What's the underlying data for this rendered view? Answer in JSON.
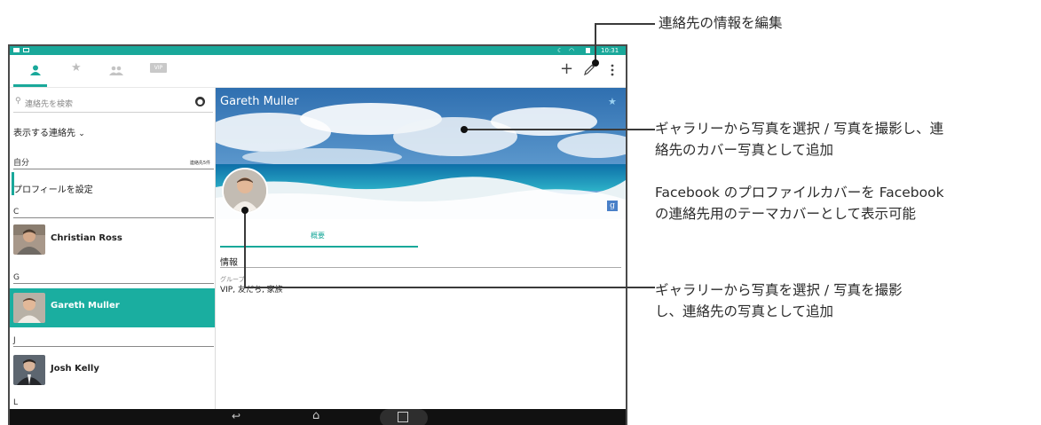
{
  "status_bar": {
    "time": "10:31"
  },
  "app_bar": {
    "tabs": [
      {
        "icon": "person-icon",
        "active": true
      },
      {
        "icon": "star-icon",
        "active": false
      },
      {
        "icon": "group-icon",
        "active": false
      },
      {
        "icon": "vip-icon",
        "label": "VIP",
        "active": false
      }
    ],
    "actions": [
      "add-icon",
      "edit-icon",
      "more-icon"
    ]
  },
  "left_panel": {
    "search_placeholder": "連絡先を検索",
    "display_contacts_label": "表示する連絡先",
    "self_section": {
      "header": "自分",
      "count": "連絡先5件",
      "setup_profile": "プロフィールを設定"
    },
    "sections": [
      {
        "letter": "C",
        "contacts": [
          "Christian Ross"
        ]
      },
      {
        "letter": "G",
        "contacts": [
          "Gareth Muller"
        ]
      },
      {
        "letter": "J",
        "contacts": [
          "Josh Kelly"
        ]
      },
      {
        "letter": "L",
        "contacts": []
      }
    ],
    "selected_contact": "Gareth Muller"
  },
  "detail": {
    "name": "Gareth Muller",
    "tab_overview": "概要",
    "info_header": "情報",
    "group_label": "グループ",
    "group_value": "VIP, 友だち, 家族",
    "google_badge": "g"
  },
  "callouts": {
    "edit": "連絡先の情報を編集",
    "cover_line1": "ギャラリーから写真を選択 / 写真を撮影し、連",
    "cover_line2": "絡先のカバー写真として追加",
    "facebook_line1": "Facebook のプロファイルカバーを Facebook",
    "facebook_line2": "の連絡先用のテーマカバーとして表示可能",
    "photo_line1": "ギャラリーから写真を選択 / 写真を撮影",
    "photo_line2": "し、連絡先の写真として追加"
  },
  "colors": {
    "accent": "#19a89a",
    "selected_row": "#1aaea0",
    "nav_bar": "#111111"
  }
}
